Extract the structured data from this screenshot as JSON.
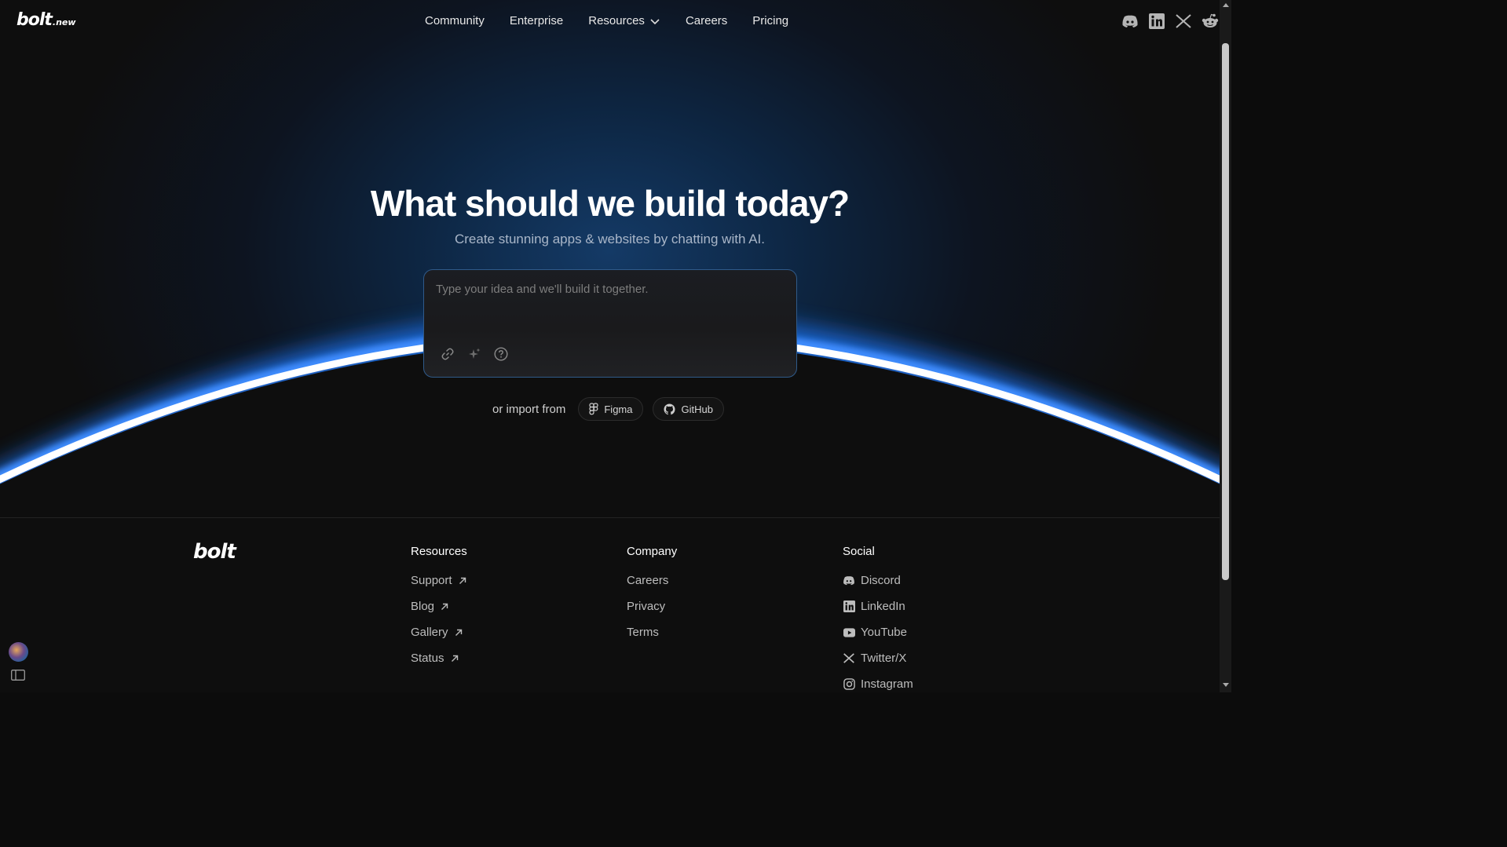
{
  "header": {
    "logo_text": "bolt",
    "logo_suffix": ".new",
    "nav": [
      {
        "label": "Community"
      },
      {
        "label": "Enterprise"
      },
      {
        "label": "Resources",
        "has_dropdown": true
      },
      {
        "label": "Careers"
      },
      {
        "label": "Pricing"
      }
    ],
    "social_icons": [
      "discord-icon",
      "linkedin-icon",
      "x-icon",
      "reddit-icon"
    ]
  },
  "hero": {
    "title": "What should we build today?",
    "subtitle": "Create stunning apps & websites by chatting with AI.",
    "prompt_placeholder": "Type your idea and we'll build it together.",
    "prompt_tools": [
      "link-icon",
      "sparkle-icon",
      "help-icon"
    ],
    "import_label": "or import from",
    "import_sources": [
      {
        "label": "Figma",
        "icon": "figma-icon"
      },
      {
        "label": "GitHub",
        "icon": "github-icon"
      }
    ]
  },
  "footer": {
    "logo_text": "bolt",
    "columns": [
      {
        "heading": "Resources",
        "links": [
          {
            "label": "Support",
            "external": true
          },
          {
            "label": "Blog",
            "external": true
          },
          {
            "label": "Gallery",
            "external": true
          },
          {
            "label": "Status",
            "external": true
          }
        ]
      },
      {
        "heading": "Company",
        "links": [
          {
            "label": "Careers"
          },
          {
            "label": "Privacy"
          },
          {
            "label": "Terms"
          }
        ]
      },
      {
        "heading": "Social",
        "links": [
          {
            "label": "Discord",
            "icon": "discord-icon"
          },
          {
            "label": "LinkedIn",
            "icon": "linkedin-icon"
          },
          {
            "label": "YouTube",
            "icon": "youtube-icon"
          },
          {
            "label": "Twitter/X",
            "icon": "x-icon"
          },
          {
            "label": "Instagram",
            "icon": "instagram-icon"
          }
        ]
      }
    ]
  },
  "colors": {
    "background": "#0e0e0e",
    "accent_glow": "#2f7bff",
    "prompt_border": "#2f5a8a"
  }
}
